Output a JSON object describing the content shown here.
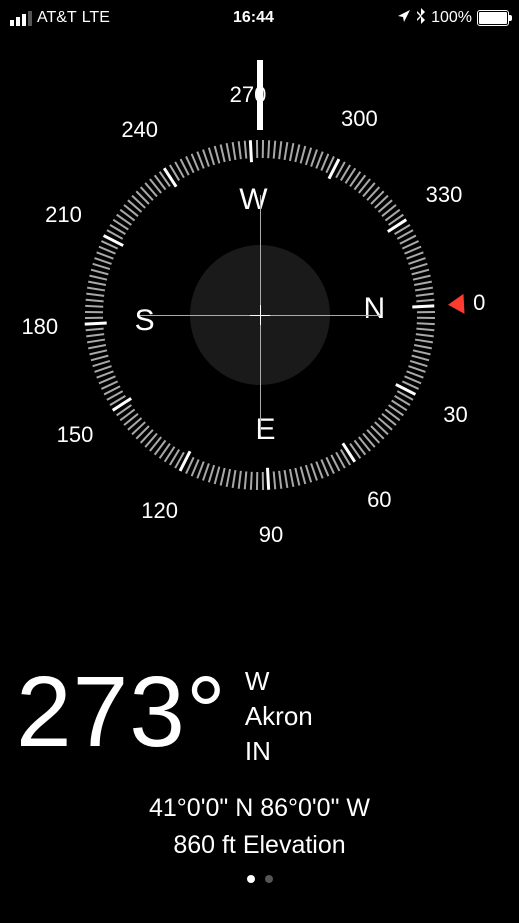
{
  "status_bar": {
    "carrier": "AT&T",
    "network": "LTE",
    "time": "16:44",
    "battery_pct": "100%",
    "location_icon": "▸",
    "bluetooth_icon": "✱"
  },
  "compass": {
    "heading_deg": 273,
    "outer_labels": [
      0,
      30,
      60,
      90,
      120,
      150,
      180,
      210,
      240,
      270,
      300,
      330
    ],
    "cardinals": {
      "N": "N",
      "E": "E",
      "S": "S",
      "W": "W"
    }
  },
  "readout": {
    "degrees": "273°",
    "direction": "W",
    "city": "Akron",
    "state": "IN",
    "coordinates": "41°0'0\" N  86°0'0\" W",
    "elevation": "860 ft Elevation"
  }
}
